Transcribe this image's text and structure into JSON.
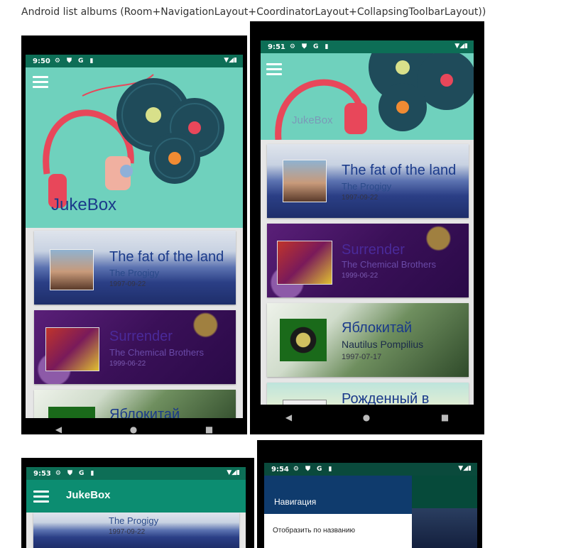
{
  "page": {
    "title": "Android list albums (Room+NavigationLayout+CoordinatorLayout+CollapsingToolbarLayout))"
  },
  "colors": {
    "status_green": "#0d6e56",
    "header_teal": "#6fd1bd",
    "toolbar_green": "#0c8d71",
    "drawer_navy": "#0f3b6d",
    "title_blue": "#1a3a8a"
  },
  "status_icons": [
    "gear-icon",
    "shield-icon",
    "google-icon",
    "sd-card-icon",
    "wifi-icon",
    "signal-icon",
    "battery-icon"
  ],
  "nav_icons": [
    "back-icon",
    "home-icon",
    "recents-icon"
  ],
  "phone1": {
    "time": "9:50",
    "header_title": "JukeBox",
    "albums": [
      {
        "title": "The fat of the land",
        "artist": "The Progigy",
        "date": "1997-09-22"
      },
      {
        "title": "Surrender",
        "artist": "The Chemical Brothers",
        "date": "1999-06-22"
      },
      {
        "title": "Яблокитай",
        "artist": "",
        "date": ""
      }
    ]
  },
  "phone2": {
    "time": "9:51",
    "header_title": "JukeBox",
    "albums": [
      {
        "title": "The fat of the land",
        "artist": "The Progigy",
        "date": "1997-09-22"
      },
      {
        "title": "Surrender",
        "artist": "The Chemical Brothers",
        "date": "1999-06-22"
      },
      {
        "title": "Яблокитай",
        "artist": "Nautilus Pompilius",
        "date": "1997-07-17"
      },
      {
        "title": "Рожденный в",
        "artist": "",
        "date": ""
      }
    ]
  },
  "phone3": {
    "time": "9:53",
    "toolbar_title": "JukeBox",
    "albums": [
      {
        "title": "",
        "artist": "The Progigy",
        "date": "1997-09-22"
      }
    ]
  },
  "phone4": {
    "time": "9:54",
    "drawer_header": "Навигация",
    "drawer_items": [
      "Отобразить по названию"
    ]
  }
}
